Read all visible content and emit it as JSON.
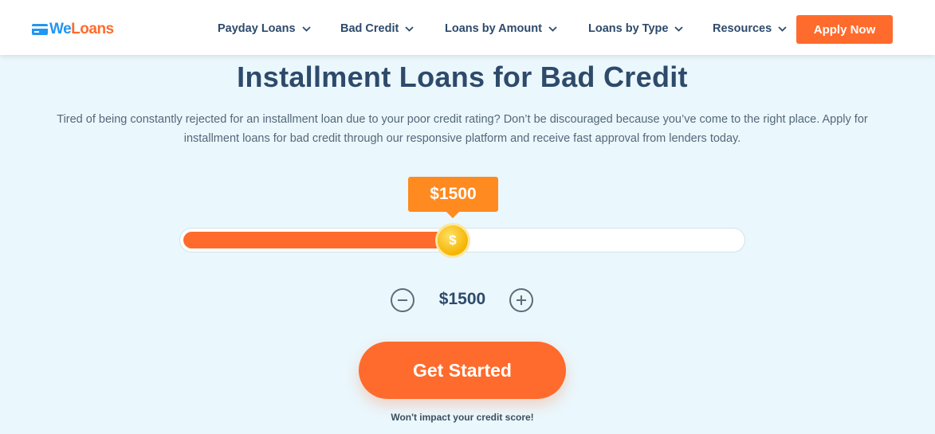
{
  "brand": {
    "part1": "We",
    "part2": "Loans",
    "color_primary": "#2196f3",
    "color_accent": "#ff6b2c"
  },
  "nav": {
    "items": [
      {
        "label": "Payday Loans",
        "icon": "chevron-down-icon"
      },
      {
        "label": "Bad Credit",
        "icon": "chevron-down-icon"
      },
      {
        "label": "Loans by Amount",
        "icon": "chevron-down-icon"
      },
      {
        "label": "Loans by Type",
        "icon": "chevron-down-icon"
      },
      {
        "label": "Resources",
        "icon": "chevron-down-icon"
      }
    ],
    "apply_label": "Apply Now"
  },
  "hero": {
    "title": "Installment Loans for Bad Credit",
    "intro_line1": "Tired of being constantly rejected for an installment loan due to your poor credit rating? Don’t be discouraged because you’ve come to the right place. Apply for",
    "intro_line2": "installment loans for bad credit through our responsive platform and receive fast approval from lenders today."
  },
  "slider": {
    "bubble_amount": "$1500",
    "fill_fraction": 0.47,
    "thumb_icon": "dollar-coin-icon",
    "thumb_symbol": "$"
  },
  "stepper": {
    "amount": "$1500",
    "minus_icon": "minus-circle-icon",
    "plus_icon": "plus-circle-icon"
  },
  "cta": {
    "label": "Get Started",
    "disclaimer": "Won't impact your credit score!"
  }
}
